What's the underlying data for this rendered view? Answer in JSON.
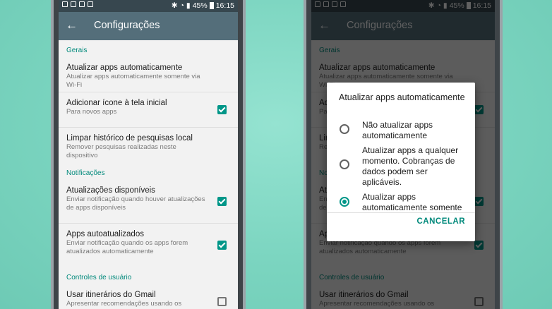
{
  "colors": {
    "accent": "#009688",
    "appbar": "#546e7a",
    "statusbar": "#37474f",
    "background": "#7fd8c4"
  },
  "status": {
    "battery": "45%",
    "time": "16:15"
  },
  "icons": {
    "back": "arrow-left-icon",
    "checkbox_on": "checkbox-checked-icon",
    "checkbox_off": "checkbox-empty-icon"
  },
  "screen1": {
    "title": "Configurações",
    "sections": {
      "general": "Gerais",
      "notifications": "Notificações",
      "user_controls": "Controles de usuário"
    },
    "items": {
      "auto_update": {
        "title": "Atualizar apps automaticamente",
        "subtitle": "Atualizar apps automaticamente somente via Wi-Fi"
      },
      "add_icon": {
        "title": "Adicionar ícone à tela inicial",
        "subtitle": "Para novos apps",
        "checked": true
      },
      "clear_history": {
        "title": "Limpar histórico de pesquisas local",
        "subtitle": "Remover pesquisas realizadas neste dispositivo"
      },
      "updates_available": {
        "title": "Atualizações disponíveis",
        "subtitle": "Enviar notificação quando houver atualizações de apps disponíveis",
        "checked": true
      },
      "apps_updated": {
        "title": "Apps autoatualizados",
        "subtitle": "Enviar notificação quando os apps forem atualizados automaticamente",
        "checked": true
      },
      "gmail_itineraries": {
        "title": "Usar itinerários do Gmail",
        "subtitle": "Apresentar recomendações usando os",
        "checked": false
      }
    }
  },
  "dialog": {
    "title": "Atualizar apps automaticamente",
    "options": [
      {
        "label": "Não atualizar apps automaticamente",
        "selected": false
      },
      {
        "label": "Atualizar apps a qualquer momento. Cobranças de dados podem ser aplicáveis.",
        "selected": false
      },
      {
        "label": "Atualizar apps automaticamente somente via Wi-Fi",
        "selected": true
      }
    ],
    "cancel": "CANCELAR"
  }
}
